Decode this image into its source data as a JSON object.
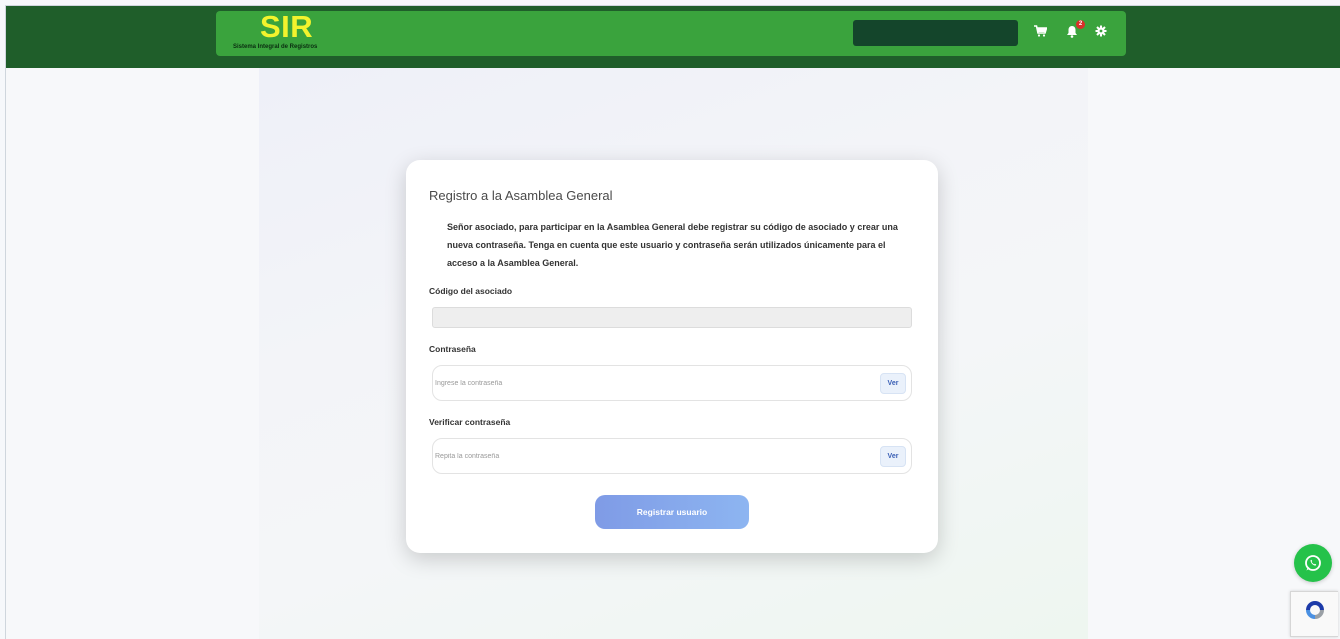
{
  "header": {
    "brand_title": "SIR",
    "brand_subtitle": "Sistema Integral de Registros",
    "notification_count": "2",
    "icons": [
      "cart-icon",
      "bell-icon",
      "gear-icon"
    ]
  },
  "form": {
    "title": "Registro a la Asamblea General",
    "intro": "Señor asociado, para participar en la Asamblea General debe registrar su código de asociado y crear una nueva contraseña. Tenga en cuenta que este usuario y contraseña serán utilizados únicamente para el acceso a la Asamblea General.",
    "code_label": "Código del asociado",
    "password_label": "Contraseña",
    "password_placeholder": "Ingrese la contraseña",
    "verify_label": "Verificar contraseña",
    "verify_placeholder": "Repita la contraseña",
    "show_label": "Ver",
    "submit_label": "Registrar usuario"
  },
  "colors": {
    "topbar": "#1f5e2a",
    "navbar": "#3aa33d",
    "brand_title": "#f3f32d",
    "submit_start": "#7f9be6",
    "submit_end": "#8db5f1",
    "whatsapp": "#25c24a"
  },
  "widgets": [
    "whatsapp-icon",
    "recaptcha-icon"
  ]
}
